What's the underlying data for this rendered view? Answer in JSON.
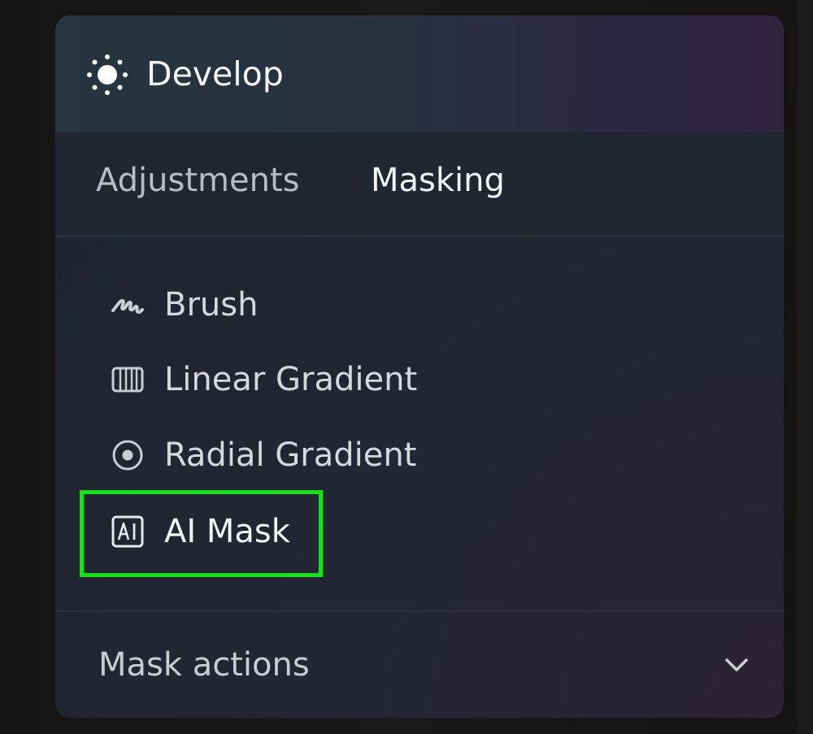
{
  "header": {
    "title": "Develop",
    "icon": "sun-icon"
  },
  "tabs": [
    {
      "label": "Adjustments",
      "active": false
    },
    {
      "label": "Masking",
      "active": true
    }
  ],
  "tools": [
    {
      "label": "Brush",
      "icon": "brush-icon"
    },
    {
      "label": "Linear Gradient",
      "icon": "linear-gradient-icon"
    },
    {
      "label": "Radial Gradient",
      "icon": "radial-gradient-icon"
    },
    {
      "label": "AI Mask",
      "icon": "ai-mask-icon",
      "highlighted": true
    }
  ],
  "mask_actions": {
    "label": "Mask actions",
    "icon": "chevron-down-icon",
    "expanded": false
  },
  "colors": {
    "highlight": "#18e11c",
    "active_text": "#f2f3f5",
    "inactive_text": "#b9bcc2"
  }
}
